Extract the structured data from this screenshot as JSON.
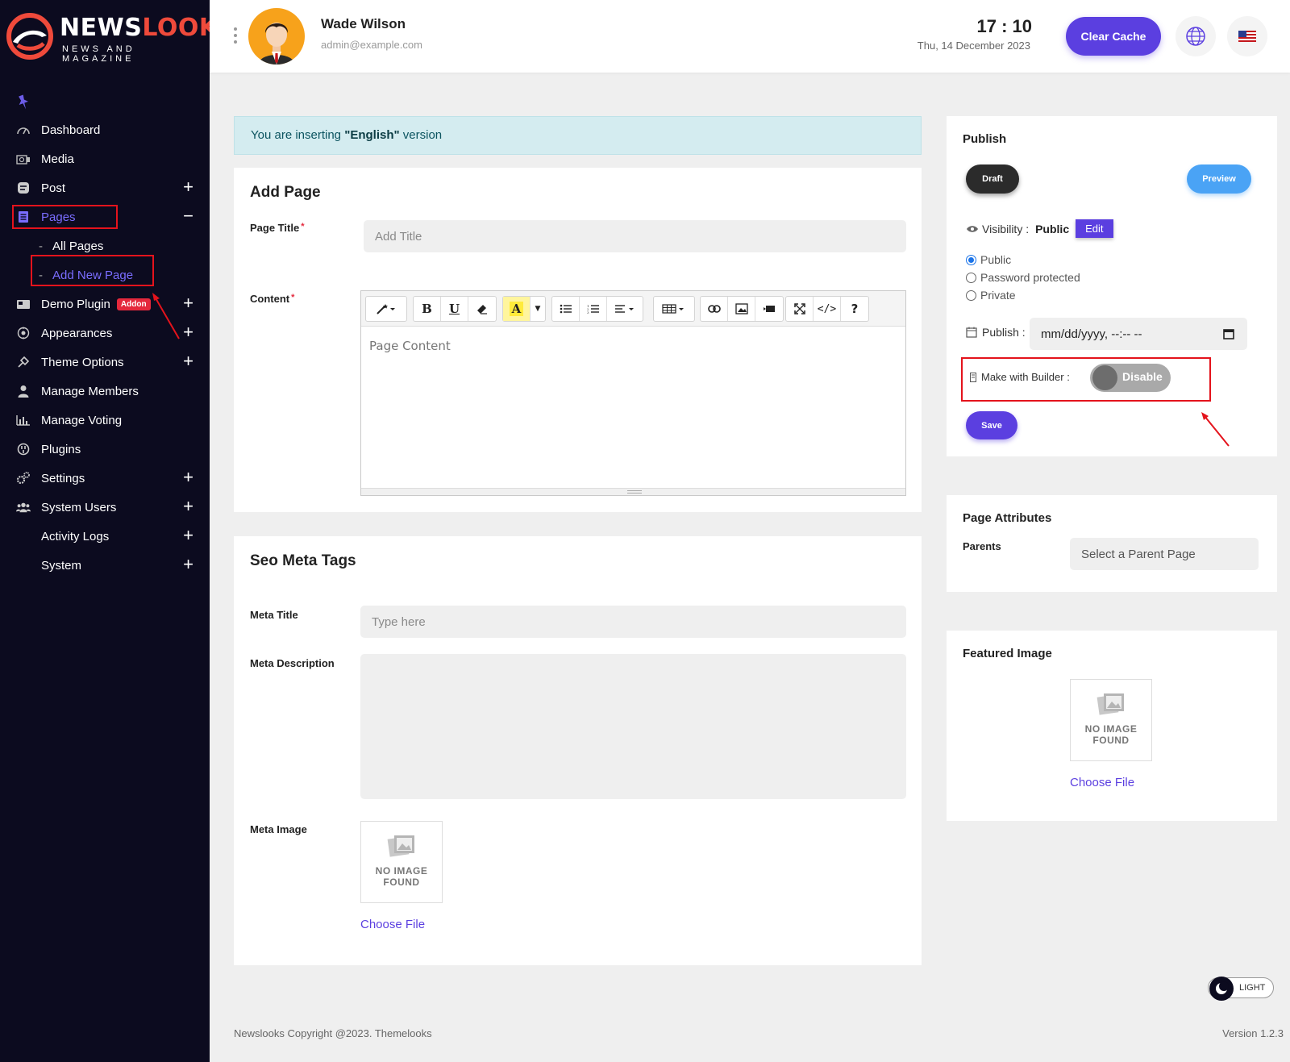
{
  "brand": {
    "name_part1": "NEWS",
    "name_part2": "LOOKS",
    "tagline": "NEWS AND MAGAZINE",
    "colors": {
      "primary": "#5b3fe0",
      "sidebar": "#0c0b1f",
      "accent_red": "#ef4a3b"
    }
  },
  "sidebar": {
    "items": [
      {
        "label": "Dashboard",
        "icon": "gauge-icon",
        "expand": ""
      },
      {
        "label": "Media",
        "icon": "media-icon",
        "expand": ""
      },
      {
        "label": "Post",
        "icon": "post-icon",
        "expand": "+"
      },
      {
        "label": "Pages",
        "icon": "pages-icon",
        "expand": "−"
      },
      {
        "label": "Demo Plugin",
        "icon": "plugin-icon",
        "expand": "+",
        "badge": "Addon"
      },
      {
        "label": "Appearances",
        "icon": "appearance-icon",
        "expand": "+"
      },
      {
        "label": "Theme Options",
        "icon": "theme-options-icon",
        "expand": "+"
      },
      {
        "label": "Manage Members",
        "icon": "user-icon",
        "expand": ""
      },
      {
        "label": "Manage Voting",
        "icon": "chart-icon",
        "expand": ""
      },
      {
        "label": "Plugins",
        "icon": "plug-icon",
        "expand": ""
      },
      {
        "label": "Settings",
        "icon": "gear-icon",
        "expand": "+"
      },
      {
        "label": "System Users",
        "icon": "users-icon",
        "expand": "+"
      },
      {
        "label": "Activity Logs",
        "icon": "",
        "expand": "+"
      },
      {
        "label": "System",
        "icon": "",
        "expand": "+"
      }
    ],
    "pages_sub": [
      {
        "dash": "-",
        "label": "All Pages"
      },
      {
        "dash": "-",
        "label": "Add New Page"
      }
    ]
  },
  "header": {
    "user_name": "Wade Wilson",
    "user_email": "admin@example.com",
    "time": "17 : 10",
    "date": "Thu, 14 December 2023",
    "clear_cache": "Clear Cache"
  },
  "alert": {
    "prefix": "You are inserting ",
    "language": "\"English\"",
    "suffix": " version"
  },
  "add_page": {
    "title": "Add Page",
    "page_title_label": "Page Title",
    "required_mark": "*",
    "page_title_placeholder": "Add Title",
    "content_label": "Content",
    "content_placeholder": "Page Content"
  },
  "toolbar": {
    "bold": "B",
    "underline": "U",
    "font_color": "A",
    "code": "</>",
    "help": "?"
  },
  "seo": {
    "title": "Seo Meta Tags",
    "meta_title_label": "Meta Title",
    "meta_title_placeholder": "Type here",
    "meta_description_label": "Meta Description",
    "meta_image_label": "Meta Image",
    "no_image_line1": "NO IMAGE",
    "no_image_line2": "FOUND",
    "choose_file": "Choose File"
  },
  "publish": {
    "title": "Publish",
    "draft": "Draft",
    "preview": "Preview",
    "visibility_label": "Visibility :",
    "visibility_value": "Public",
    "edit": "Edit",
    "options": [
      "Public",
      "Password protected",
      "Private"
    ],
    "selected_option": "Public",
    "publish_label": "Publish :",
    "publish_placeholder": "mm/dd/yyyy, --:-- --",
    "builder_label": "Make with Builder :",
    "builder_state": "Disable",
    "save": "Save"
  },
  "attributes": {
    "title": "Page Attributes",
    "parents_label": "Parents",
    "parents_placeholder": "Select a Parent Page"
  },
  "featured": {
    "title": "Featured Image",
    "no_image_line1": "NO IMAGE",
    "no_image_line2": "FOUND",
    "choose_file": "Choose File"
  },
  "theme_toggle": "LIGHT",
  "footer": {
    "copyright": "Newslooks Copyright @2023. Themelooks",
    "version": "Version 1.2.3"
  }
}
